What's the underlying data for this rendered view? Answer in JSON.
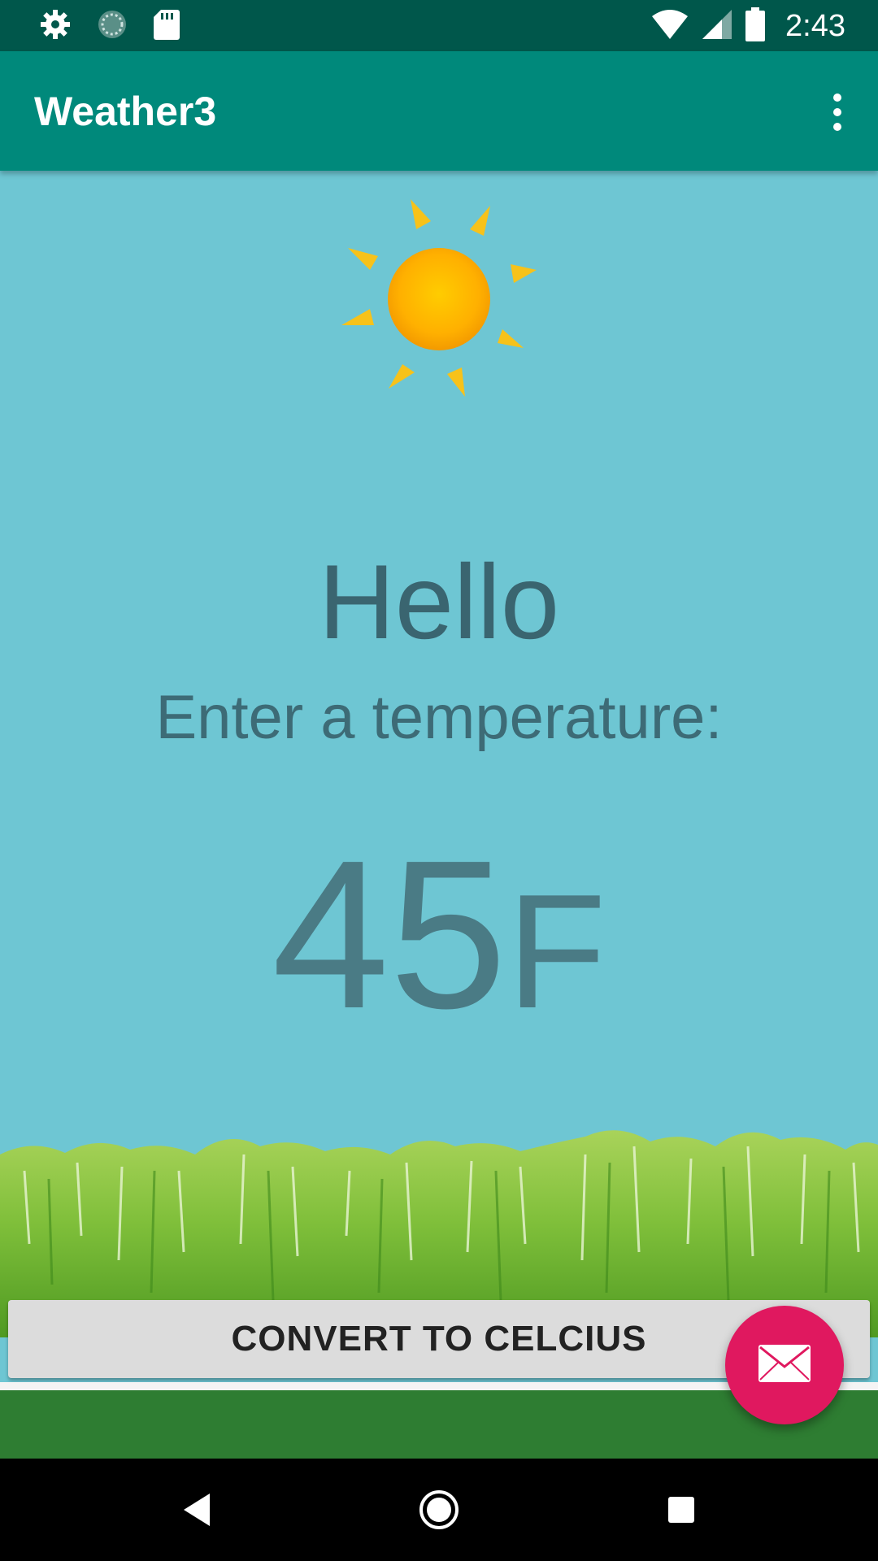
{
  "status_bar": {
    "time": "2:43",
    "left_icons": [
      "settings-icon",
      "sync-icon",
      "sd-card-icon"
    ],
    "right_icons": [
      "wifi-icon",
      "cell-signal-icon",
      "battery-icon"
    ]
  },
  "app_bar": {
    "title": "Weather3",
    "menu_icon": "overflow-menu-icon"
  },
  "main": {
    "weather_icon": "sun-icon",
    "greeting": "Hello",
    "prompt": "Enter a temperature:",
    "temperature_value": "45",
    "temperature_unit": "F",
    "convert_button_label": "CONVERT TO CELCIUS",
    "fab_icon": "mail-icon"
  },
  "nav_bar": {
    "buttons": [
      "back-icon",
      "home-icon",
      "recents-icon"
    ]
  },
  "colors": {
    "status_bar": "#00574b",
    "app_bar": "#00897b",
    "sky": "#6ec6d3",
    "fab": "#e0185f",
    "green_band": "#2e7d32"
  }
}
